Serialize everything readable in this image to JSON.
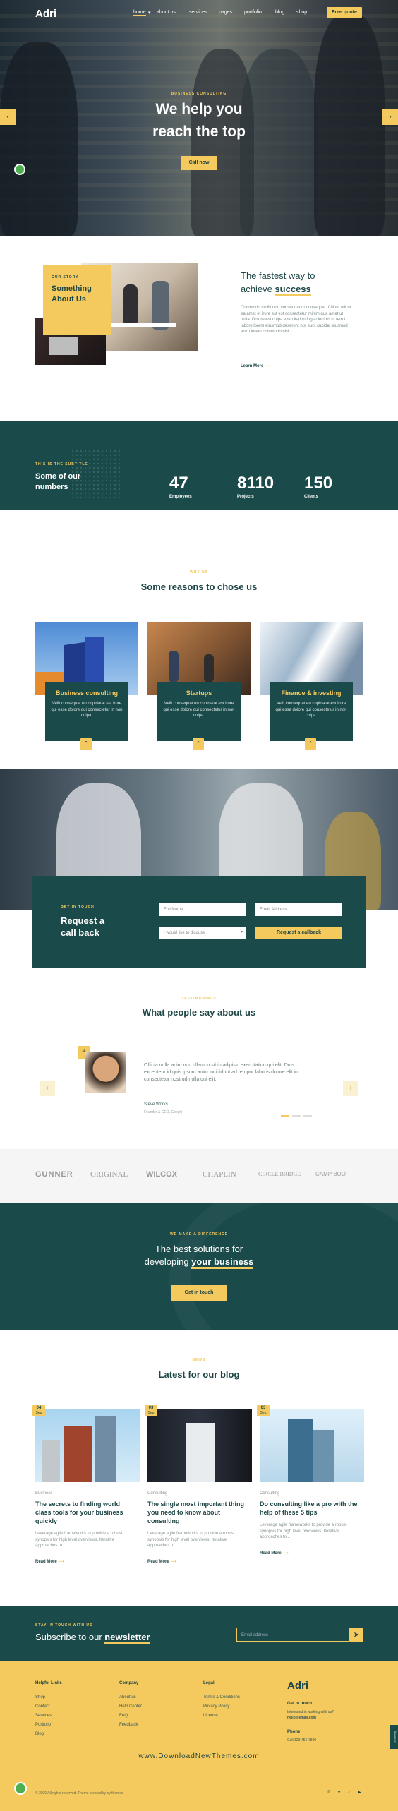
{
  "nav": {
    "logo": "Adri",
    "items": [
      "home",
      "about us",
      "services",
      "pages",
      "portfolio",
      "blog",
      "shop"
    ],
    "quote": "Free quote"
  },
  "hero": {
    "eyebrow": "BUSINESS CONSULTING",
    "title_1": "We help you",
    "title_2": "reach the top",
    "cta": "Call now",
    "prev": "‹",
    "next": "›"
  },
  "about": {
    "badge_label": "OUR STORY",
    "badge_title": "Something About Us",
    "heading_1": "The fastest way to",
    "heading_2": "achieve",
    "heading_highlight": "success",
    "text": "Commodo mollit non consequat ut consequat. Cillum elit ut ea amet et irure est est consectetur minim qua amet ut nulla. Dolore est culpa exercitation fugiat incidid ut tem t labore lorem eiusmod deserunt nisi sunt cupidat eiusmod enim lorem commodo nisi.",
    "link": "Learn More"
  },
  "stats": {
    "subtitle": "THIS IS THE SUBTITLE",
    "title": "Some of our numbers",
    "items": [
      {
        "value": "47",
        "label": "Employees"
      },
      {
        "value": "8110",
        "label": "Projects"
      },
      {
        "value": "150",
        "label": "Clients"
      }
    ]
  },
  "reasons": {
    "label": "WHY US",
    "title": "Some reasons to chose us",
    "cards": [
      {
        "title": "Business consulting",
        "text": "Velit consequat eu cupidatat est irure qui esse dolore qui consectetur in non culpa."
      },
      {
        "title": "Startups",
        "text": "Velit consequat eu cupidatat est irure qui esse dolore qui consectetur in non culpa."
      },
      {
        "title": "Finance & investing",
        "text": "Velit consequat eu cupidatat est irure qui esse dolore qui consectetur in non culpa."
      }
    ]
  },
  "callback": {
    "label": "GET IN TOUCH",
    "title": "Request a call back",
    "name_ph": "Full Name",
    "email_ph": "Email Address",
    "topic": "I would like to discuss",
    "submit": "Request a callback"
  },
  "testimonials": {
    "label": "TESTIMONIALS",
    "title": "What people say about us",
    "quote": "Officia nulla anim non ullamco sit in adipisic exercitation qui elit. Duis excepteur id quis ipsum anim incididunt ad tempor laboris dolore elit in consectetur nostrud nulla qui elit.",
    "name": "Steve Works",
    "role": "Founder & CEO, Google"
  },
  "logos": [
    "GUNNER",
    "ORIGINAL",
    "WILCOX",
    "CHAPLIN",
    "CIRCLE BRIDGE",
    "CAMP BOO"
  ],
  "solutions": {
    "label": "WE MAKE A DIFFERENCE",
    "line1": "The best solutions for",
    "line2": "developing",
    "highlight": "your business",
    "cta": "Get in touch"
  },
  "blog": {
    "label": "NEWS",
    "title": "Latest for our blog",
    "posts": [
      {
        "day": "04",
        "month": "Sep",
        "cat": "Business",
        "title": "The secrets to finding world class tools for your business quickly",
        "text": "Leverage agile frameworks to provide a robust synopsis for high level overviews. Iterative approaches to...",
        "more": "Read More"
      },
      {
        "day": "03",
        "month": "Sep",
        "cat": "Consulting",
        "title": "The single most important thing you need to know about consulting",
        "text": "Leverage agile frameworks to provide a robust synopsis for high level overviews. Iterative approaches to...",
        "more": "Read More"
      },
      {
        "day": "03",
        "month": "Sep",
        "cat": "Consulting",
        "title": "Do consulting like a pro with the help of these 5 tips",
        "text": "Leverage agile frameworks to provide a robust synopsis for high level overviews. Iterative approaches to...",
        "more": "Read More"
      }
    ]
  },
  "subscribe": {
    "label": "STAY IN TOUCH WITH US",
    "text": "Subscribe to our",
    "highlight": "newsletter",
    "placeholder": "Email address"
  },
  "footer": {
    "col1": {
      "title": "Helpful Links",
      "items": [
        "Shop",
        "Contact",
        "Services",
        "Portfolio",
        "Blog"
      ]
    },
    "col2": {
      "title": "Company",
      "items": [
        "About us",
        "Help Center",
        "FAQ",
        "Feedback"
      ]
    },
    "col3": {
      "title": "Legal",
      "items": [
        "Terms & Conditions",
        "Privacy Policy",
        "License"
      ]
    },
    "logo": "Adri",
    "touch_title": "Get in touch",
    "touch_text": "Interested in working with us?",
    "email": "hello@email.com",
    "phone_title": "Phone",
    "phone": "Call 123-456-7890",
    "watermark": "www.DownloadNewThemes.com",
    "copyright": "© 2020 All rights reserved. Theme created by xyfthemes",
    "side_tab": "Scroll top"
  }
}
